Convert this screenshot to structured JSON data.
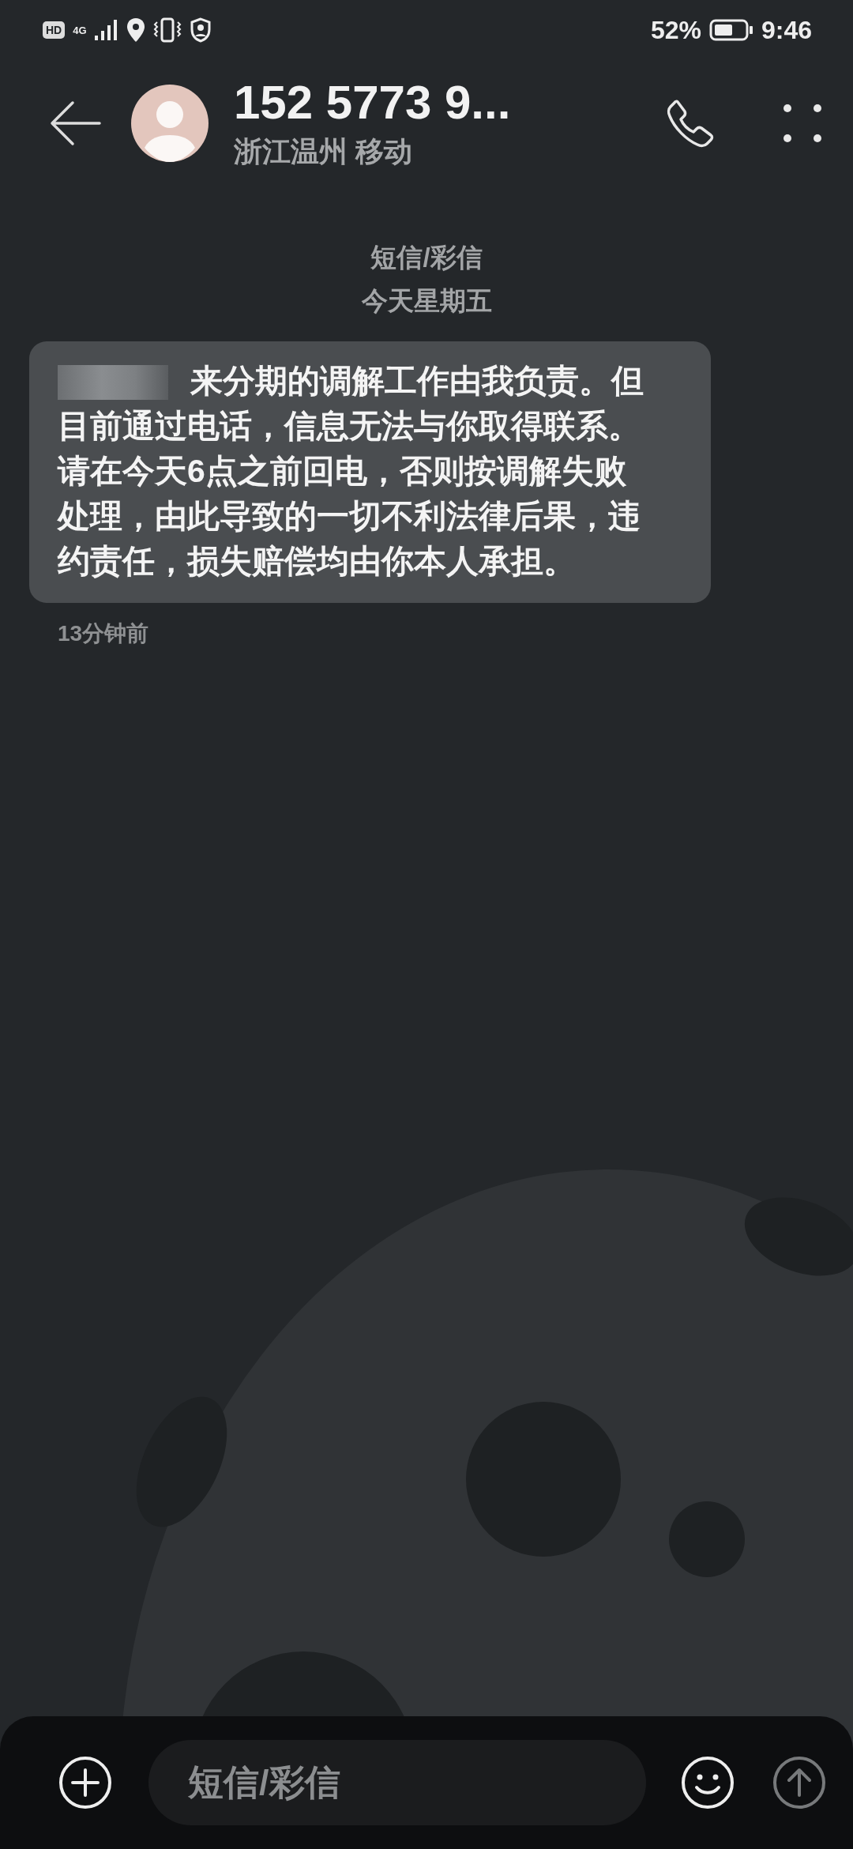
{
  "status_bar": {
    "hd": "HD",
    "network": "4G",
    "battery": "52%",
    "time": "9:46"
  },
  "header": {
    "title": "152 5773 9...",
    "subtitle": "浙江温州 移动"
  },
  "thread": {
    "type_label": "短信/彩信",
    "date": "今天星期五"
  },
  "messages": [
    {
      "text": "来分期的调解工作由我负责。但目前通过电话，信息无法与你取得联系。请在今天6点之前回电，否则按调解失败处理，由此导致的一切不利法律后果，违约责任，损失赔偿均由你本人承担。",
      "time": "13分钟前"
    }
  ],
  "compose": {
    "placeholder": "短信/彩信"
  }
}
